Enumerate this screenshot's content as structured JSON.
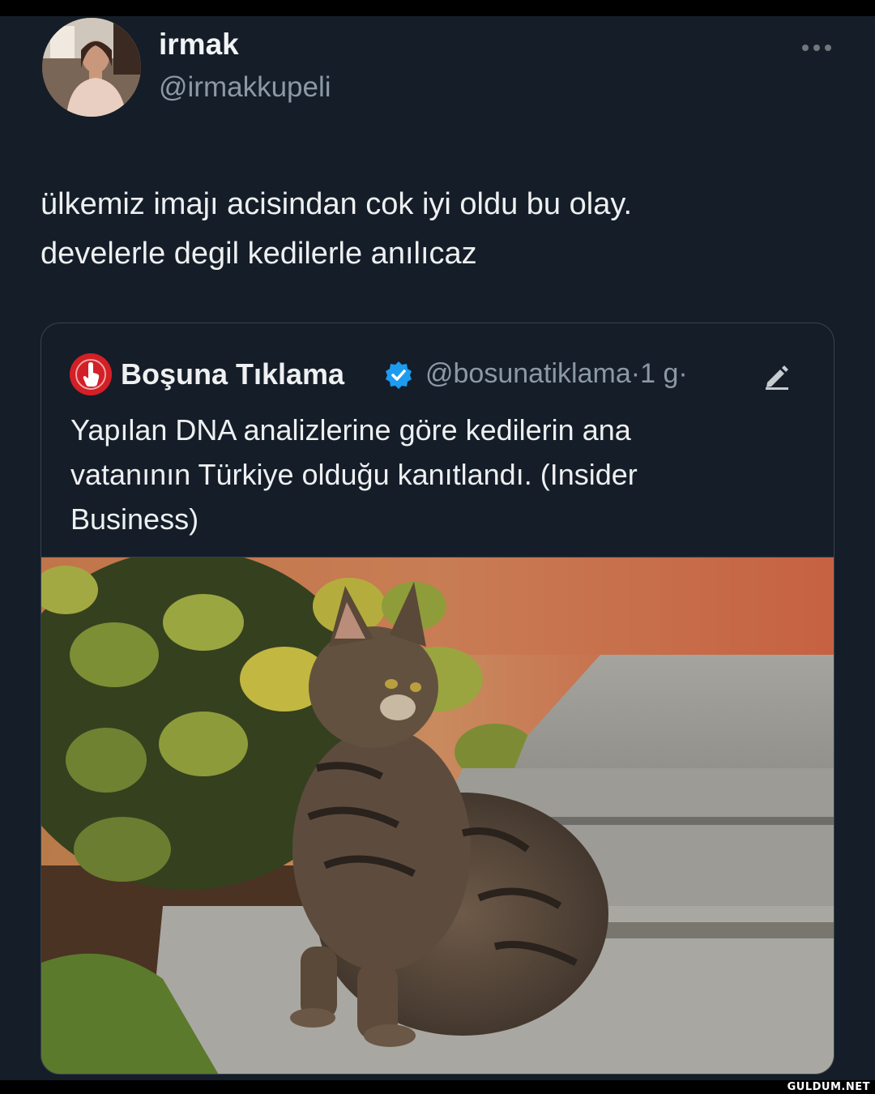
{
  "tweet": {
    "author_name": "irmak",
    "author_handle": "@irmakkupeli",
    "more_icon": "more-horizontal-icon",
    "text_lines": [
      "ülkemiz imajı acisindan cok iyi oldu bu olay.",
      "develerle degil kedilerle anılıcaz"
    ]
  },
  "quoted_tweet": {
    "author_name": "Boşuna Tıklama",
    "author_handle": "@bosunatiklama",
    "separator": "·",
    "time_ago": "1 g",
    "verified_icon": "verified-badge-icon",
    "edit_icon": "edited-pencil-icon",
    "text_lines": [
      "Yapılan DNA analizlerine göre kedilerin ana",
      "vatanının Türkiye olduğu kanıtlandı. (Insider",
      "Business)"
    ],
    "media": "photo of a tabby cat sitting on stone steps beside ivy"
  },
  "watermark": "GULDUM.NET",
  "colors": {
    "background": "#151d28",
    "text_primary": "#e7e9ea",
    "text_secondary": "#8b98a5",
    "verified_blue": "#1d9bf0",
    "border": "#38444d"
  }
}
